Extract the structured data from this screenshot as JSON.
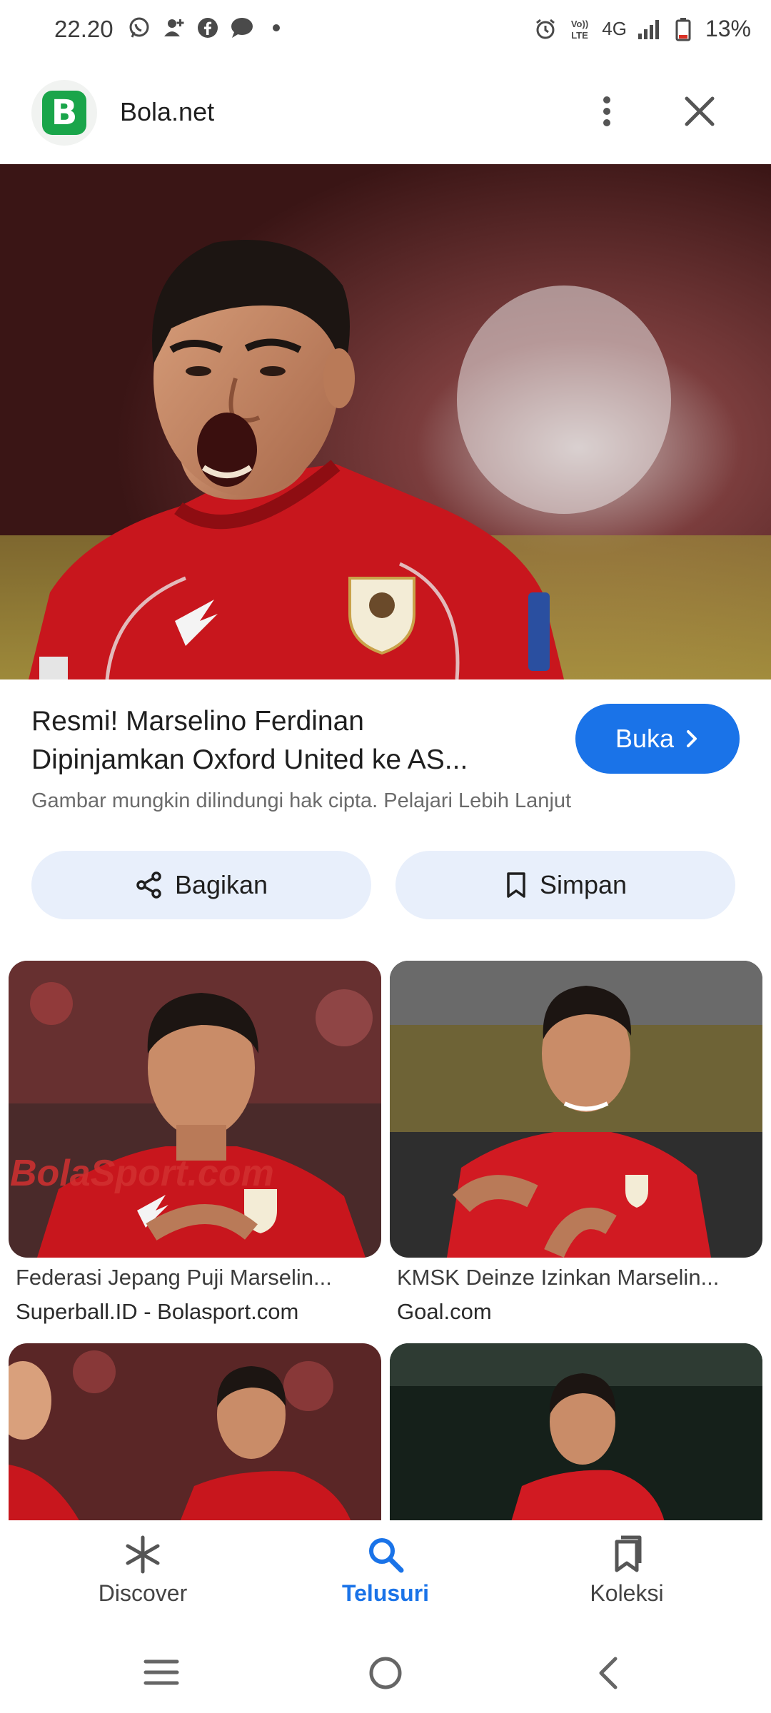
{
  "status_bar": {
    "time": "22.20",
    "battery": "13%",
    "network": "4G"
  },
  "header": {
    "logo_letter": "B",
    "site_name": "Bola.net"
  },
  "result": {
    "title_line1": "Resmi! Marselino Ferdinan",
    "title_line2": "Dipinjamkan Oxford United ke AS...",
    "open_label": "Buka",
    "copyright_note": "Gambar mungkin dilindungi hak cipta. Pelajari Lebih Lanjut",
    "share_label": "Bagikan",
    "save_label": "Simpan"
  },
  "related": [
    {
      "title": "Federasi Jepang Puji Marselin...",
      "source": "Superball.ID - Bolasport.com",
      "watermark": "BolaSport.com"
    },
    {
      "title": "KMSK Deinze Izinkan Marselin...",
      "source": "Goal.com"
    }
  ],
  "bottom_nav": {
    "items": [
      {
        "label": "Discover",
        "icon": "asterisk-icon",
        "active": false
      },
      {
        "label": "Telusuri",
        "icon": "search-icon",
        "active": true
      },
      {
        "label": "Koleksi",
        "icon": "collections-icon",
        "active": false
      }
    ]
  },
  "colors": {
    "accent": "#1a73e8",
    "chip_bg": "#e8effb",
    "jersey_red": "#c8161d",
    "logo_green": "#1aa54a"
  }
}
